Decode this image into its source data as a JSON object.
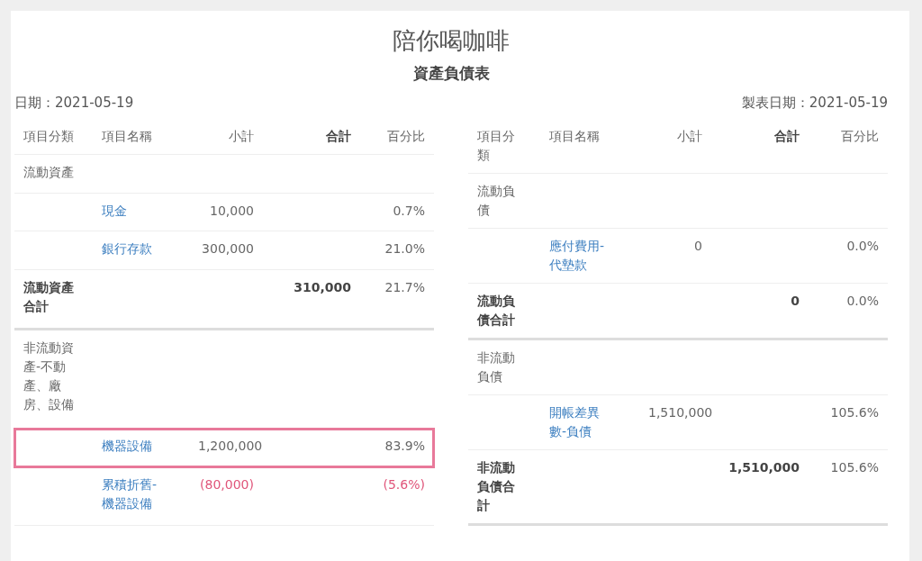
{
  "company": "陪你喝咖啡",
  "report_title": "資產負債表",
  "date_label": "日期：2021-05-19",
  "made_date_label": "製表日期：2021-05-19",
  "tables": [
    {
      "columns": [
        "項目分類",
        "項目名稱",
        "小計",
        "合計",
        "百分比"
      ],
      "rows": [
        {
          "kind": "group",
          "category": "流動資產"
        },
        {
          "kind": "item",
          "name": "現金",
          "subtotal": "10,000",
          "percent": "0.7%",
          "negative": false,
          "highlighted": false
        },
        {
          "kind": "item",
          "name": "銀行存款",
          "subtotal": "300,000",
          "percent": "21.0%",
          "negative": false,
          "highlighted": false
        },
        {
          "kind": "total",
          "category": "流動資產合計",
          "total": "310,000",
          "percent": "21.7%"
        },
        {
          "kind": "group",
          "category": "非流動資產-不動產、廠房、設備"
        },
        {
          "kind": "item",
          "name": "機器設備",
          "subtotal": "1,200,000",
          "percent": "83.9%",
          "negative": false,
          "highlighted": true
        },
        {
          "kind": "item",
          "name": "累積折舊-機器設備",
          "subtotal": "(80,000)",
          "percent": "(5.6%)",
          "negative": true,
          "highlighted": false
        }
      ]
    },
    {
      "columns": [
        "項目分類",
        "項目名稱",
        "小計",
        "合計",
        "百分比"
      ],
      "rows": [
        {
          "kind": "group",
          "category": "流動負債"
        },
        {
          "kind": "item",
          "name": "應付費用-代墊款",
          "subtotal": "0",
          "percent": "0.0%",
          "negative": false,
          "highlighted": false
        },
        {
          "kind": "total",
          "category": "流動負債合計",
          "total": "0",
          "percent": "0.0%"
        },
        {
          "kind": "group",
          "category": "非流動負債"
        },
        {
          "kind": "item",
          "name": "開帳差異數-負債",
          "subtotal": "1,510,000",
          "percent": "105.6%",
          "negative": false,
          "highlighted": false
        },
        {
          "kind": "total",
          "category": "非流動負債合計",
          "total": "1,510,000",
          "percent": "105.6%"
        }
      ]
    }
  ]
}
